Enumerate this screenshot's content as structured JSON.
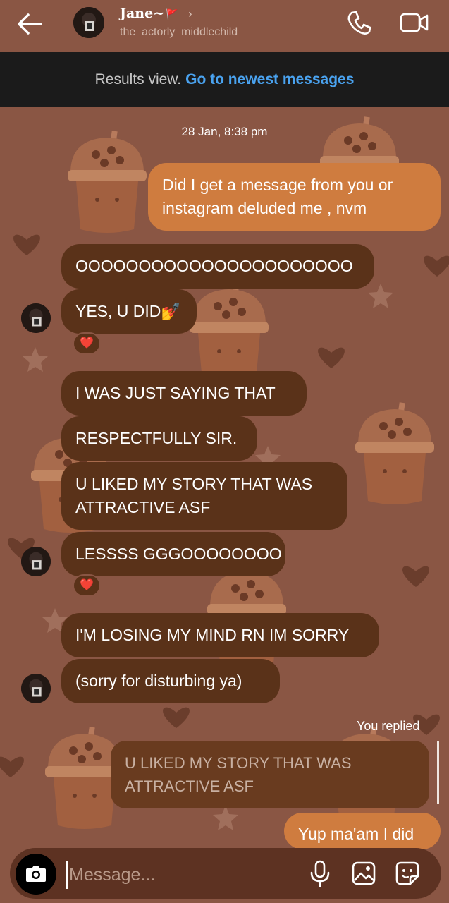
{
  "header": {
    "contact_name": "Jane~",
    "name_flag": "🚩",
    "chevron": "›",
    "username": "the_actorly_middlechild",
    "icons": [
      "back-arrow-icon",
      "phone-icon",
      "video-camera-icon"
    ]
  },
  "banner": {
    "text": "Results view.",
    "link": "Go to newest messages"
  },
  "thread": {
    "timestamp": "28 Jan, 8:38 pm",
    "messages": [
      {
        "from": "me",
        "text": "Did I get a message from you or instagram deluded me , nvm"
      },
      {
        "from": "them",
        "text": "OOOOOOOOOOOOOOOOOOOOOO"
      },
      {
        "from": "them",
        "text": "YES, U DID💅",
        "reaction": "❤️"
      },
      {
        "from": "them",
        "text": "I WAS JUST SAYING THAT"
      },
      {
        "from": "them",
        "text": "RESPECTFULLY SIR."
      },
      {
        "from": "them",
        "text": "U LIKED MY STORY THAT WAS ATTRACTIVE ASF"
      },
      {
        "from": "them",
        "text": "LESSSS GGGOOOOOOOO",
        "reaction": "❤️"
      },
      {
        "from": "them",
        "text": "I'M LOSING MY MIND RN IM SORRY"
      },
      {
        "from": "them",
        "text": "(sorry for disturbing ya)"
      }
    ],
    "replied_label": "You replied",
    "quoted_text": "U LIKED MY STORY THAT WAS ATTRACTIVE ASF",
    "reply_text": "Yup ma'am I did"
  },
  "composer": {
    "placeholder": "Message...",
    "icons": [
      "camera-icon",
      "microphone-icon",
      "gallery-icon",
      "sticker-icon"
    ]
  },
  "colors": {
    "background": "#8a5644",
    "incoming_bubble": "#5a3219",
    "outgoing_bubble": "#cf7c3f",
    "banner_bg": "#1b1b1b",
    "link": "#4aa3f0",
    "heart": "#ff2a3a"
  }
}
